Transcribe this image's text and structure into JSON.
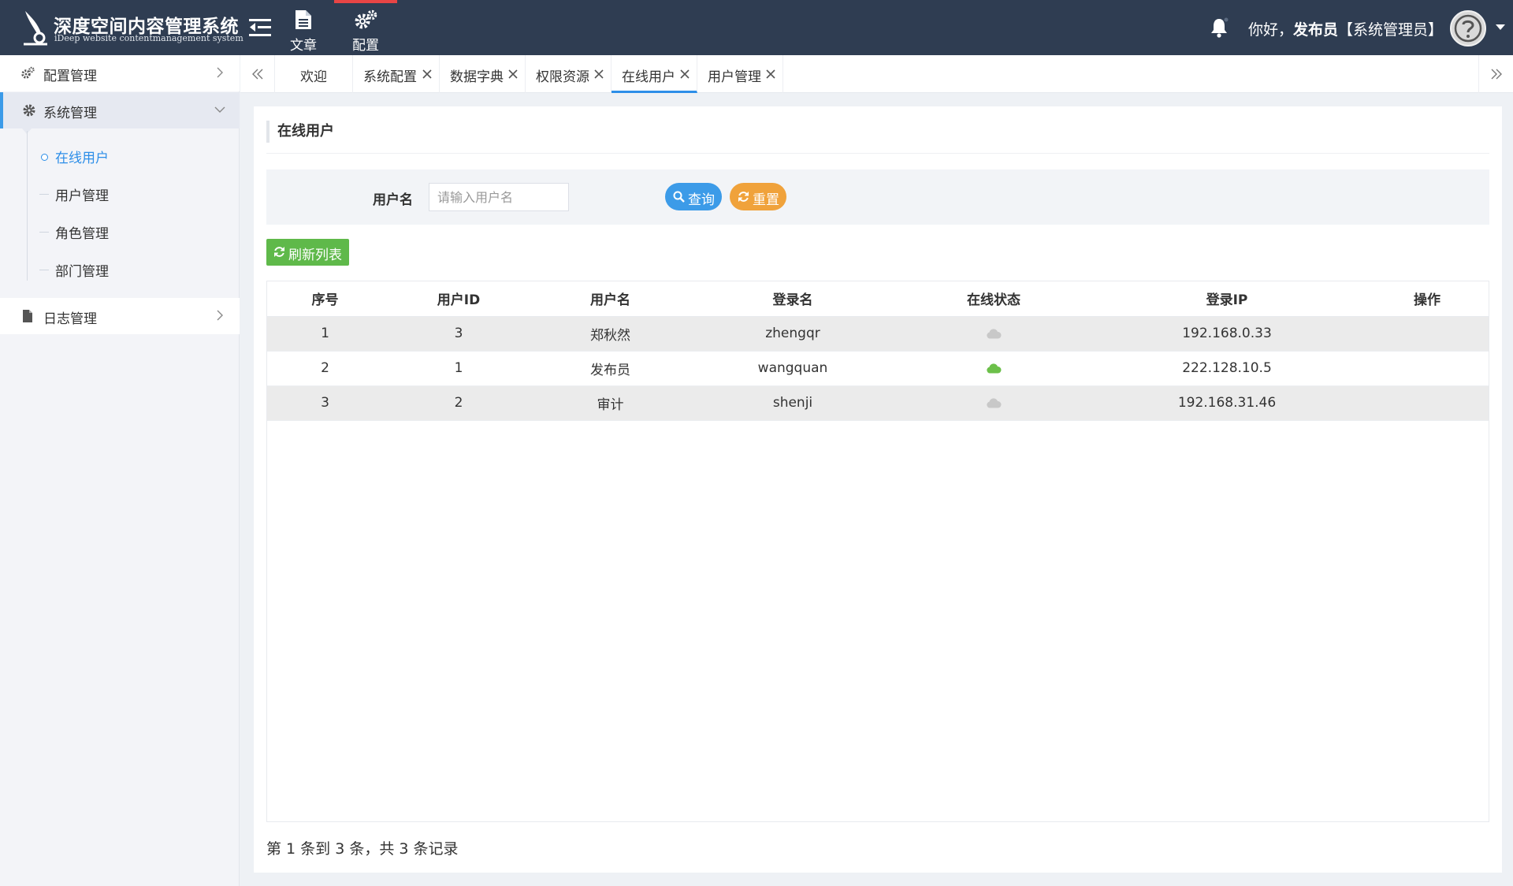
{
  "header": {
    "title": "深度空间内容管理系统",
    "subtitle": "iDeep website contentmanagement system",
    "nav": [
      {
        "label": "文章",
        "icon": "document-icon"
      },
      {
        "label": "配置",
        "icon": "gears-icon"
      }
    ],
    "greeting_prefix": "你好，",
    "user_name": "发布员",
    "user_role": "【系统管理员】"
  },
  "sidebar": {
    "groups": [
      {
        "label": "配置管理",
        "icon": "cogs-icon"
      },
      {
        "label": "系统管理",
        "icon": "gear-icon"
      },
      {
        "label": "日志管理",
        "icon": "file-icon"
      }
    ],
    "subitems": [
      {
        "label": "在线用户"
      },
      {
        "label": "用户管理"
      },
      {
        "label": "角色管理"
      },
      {
        "label": "部门管理"
      }
    ]
  },
  "tabs": [
    {
      "label": "欢迎",
      "closable": false
    },
    {
      "label": "系统配置",
      "closable": true
    },
    {
      "label": "数据字典",
      "closable": true
    },
    {
      "label": "权限资源",
      "closable": true
    },
    {
      "label": "在线用户",
      "closable": true,
      "active": true
    },
    {
      "label": "用户管理",
      "closable": true
    }
  ],
  "page": {
    "title": "在线用户",
    "search": {
      "label": "用户名",
      "placeholder": "请输入用户名",
      "query_label": "查询",
      "reset_label": "重置"
    },
    "refresh_label": "刷新列表",
    "table": {
      "columns": [
        "序号",
        "用户ID",
        "用户名",
        "登录名",
        "在线状态",
        "登录IP",
        "操作"
      ],
      "rows": [
        {
          "index": "1",
          "user_id": "3",
          "user_name": "郑秋然",
          "login_name": "zhengqr",
          "online": false,
          "ip": "192.168.0.33"
        },
        {
          "index": "2",
          "user_id": "1",
          "user_name": "发布员",
          "login_name": "wangquan",
          "online": true,
          "ip": "222.128.10.5"
        },
        {
          "index": "3",
          "user_id": "2",
          "user_name": "审计",
          "login_name": "shenji",
          "online": false,
          "ip": "192.168.31.46"
        }
      ]
    },
    "pager_text": "第 1 条到 3 条，共 3 条记录"
  },
  "colors": {
    "header_bg": "#2f3d52",
    "accent": "#3c9be8",
    "reset": "#f0a23b",
    "refresh": "#5fb94a",
    "online": "#6cc04a",
    "offline": "#c8c8c8"
  }
}
